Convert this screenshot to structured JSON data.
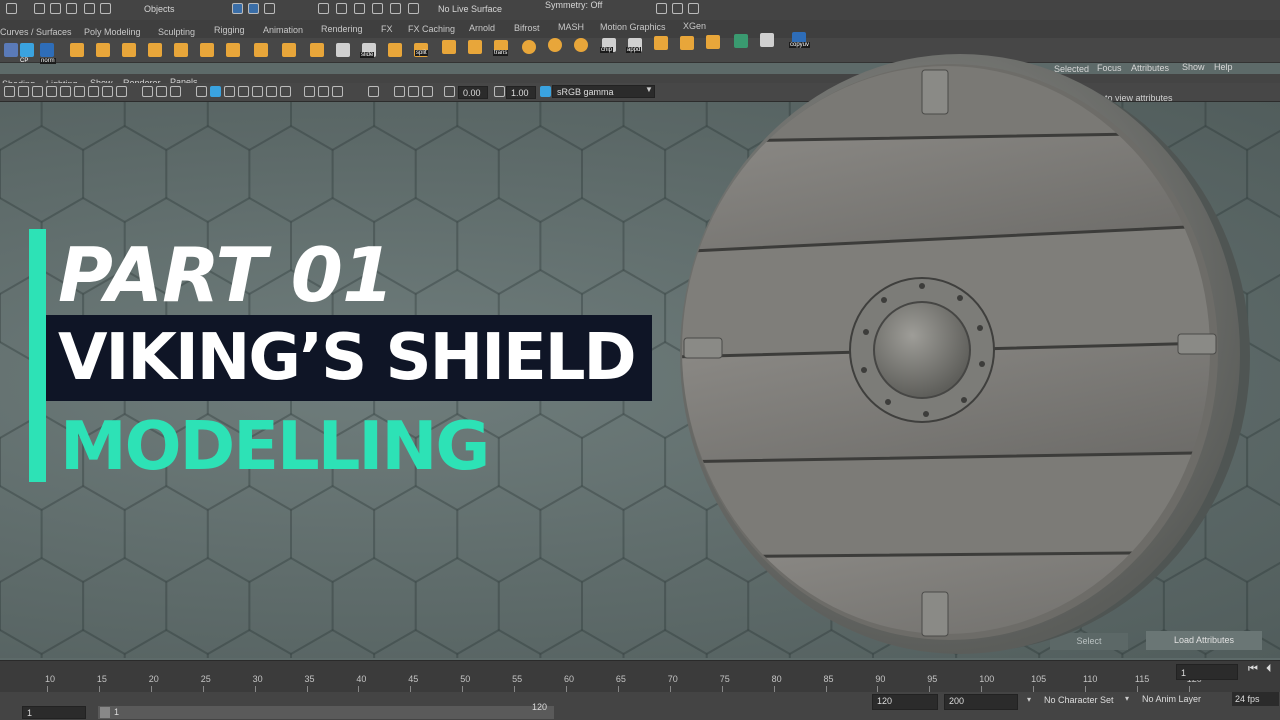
{
  "status_line": {
    "mode_dropdown": "Objects",
    "live_surface": "No Live Surface",
    "symmetry": "Symmetry: Off"
  },
  "shelf_tabs": [
    "Curves / Surfaces",
    "Poly Modeling",
    "Sculpting",
    "Rigging",
    "Animation",
    "Rendering",
    "FX",
    "FX Caching",
    "Arnold",
    "Bifrost",
    "MASH",
    "Motion Graphics",
    "XGen"
  ],
  "shelf_icon_labels": {
    "cp": "CP",
    "norm": "norm",
    "slide": "slide",
    "split": "split",
    "trans": "trans",
    "chip": "chip",
    "appd": "appd",
    "copyuv": "copyuv"
  },
  "panel_menu": [
    "Shading",
    "Lighting",
    "Show",
    "Renderer",
    "Panels"
  ],
  "panel_toolbar": {
    "exposure": "0.00",
    "gamma": "1.00",
    "color_space": "sRGB gamma"
  },
  "attribute_editor": {
    "menu": [
      "Selected",
      "Focus",
      "Attributes",
      "Show",
      "Help"
    ],
    "hint": "to view attributes",
    "select_button": "Select",
    "load_button": "Load Attributes"
  },
  "time_slider": {
    "ticks": [
      "10",
      "15",
      "20",
      "25",
      "30",
      "35",
      "40",
      "45",
      "50",
      "55",
      "60",
      "65",
      "70",
      "75",
      "80",
      "85",
      "90",
      "95",
      "100",
      "105",
      "110",
      "115",
      "120"
    ],
    "current_frame": "1"
  },
  "range_slider": {
    "start": "1",
    "range_start": "1",
    "range_end": "120",
    "anim_end": "120",
    "playback_end": "200",
    "character_set": "No Character Set",
    "anim_layer": "No Anim Layer",
    "fps": "24 fps"
  },
  "overlay": {
    "line1": "PART 01",
    "line2": "VIKING’S SHIELD",
    "line3": "MODELLING"
  },
  "colors": {
    "accent": "#2de2b6",
    "title_bg": "#0f1526",
    "viewport": "#5e6b6a"
  }
}
